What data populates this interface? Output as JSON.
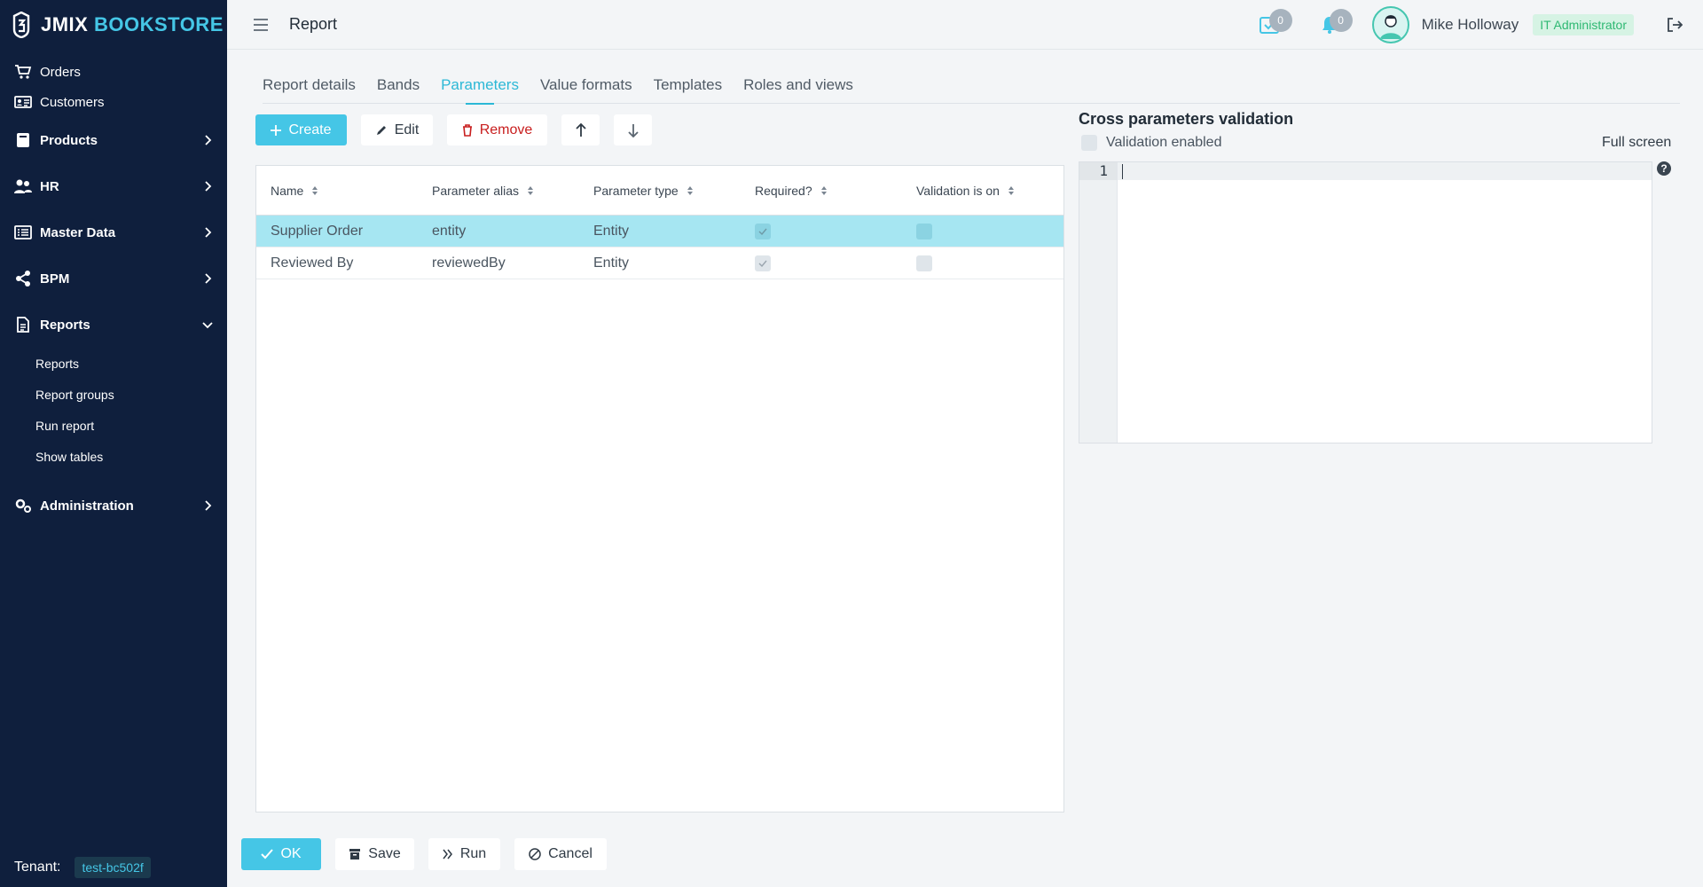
{
  "app": {
    "brand_left": "JMIX",
    "brand_right": "BOOKSTORE"
  },
  "sidebar": {
    "items": [
      {
        "label": "Orders"
      },
      {
        "label": "Customers"
      },
      {
        "label": "Products"
      },
      {
        "label": "HR"
      },
      {
        "label": "Master Data"
      },
      {
        "label": "BPM"
      },
      {
        "label": "Reports"
      },
      {
        "label": "Administration"
      }
    ],
    "reports_sub": [
      {
        "label": "Reports"
      },
      {
        "label": "Report groups"
      },
      {
        "label": "Run report"
      },
      {
        "label": "Show tables"
      }
    ],
    "tenant_label": "Tenant:",
    "tenant_value": "test-bc502f"
  },
  "header": {
    "title": "Report",
    "inbox_count": "0",
    "notifications_count": "0",
    "user_name": "Mike Holloway",
    "role": "IT Administrator"
  },
  "tabs": [
    {
      "label": "Report details"
    },
    {
      "label": "Bands"
    },
    {
      "label": "Parameters",
      "active": true
    },
    {
      "label": "Value formats"
    },
    {
      "label": "Templates"
    },
    {
      "label": "Roles and views"
    }
  ],
  "toolbar": {
    "create": "Create",
    "edit": "Edit",
    "remove": "Remove"
  },
  "table": {
    "columns": [
      "Name",
      "Parameter alias",
      "Parameter type",
      "Required?",
      "Validation is on"
    ],
    "rows": [
      {
        "name": "Supplier Order",
        "alias": "entity",
        "type": "Entity",
        "required": true,
        "validation": false
      },
      {
        "name": "Reviewed By",
        "alias": "reviewedBy",
        "type": "Entity",
        "required": true,
        "validation": false
      }
    ]
  },
  "validation_panel": {
    "title": "Cross parameters validation",
    "enabled_label": "Validation enabled",
    "fullscreen": "Full screen",
    "line_number": "1",
    "help": "?"
  },
  "footer": {
    "ok": "OK",
    "save": "Save",
    "run": "Run",
    "cancel": "Cancel"
  },
  "colors": {
    "sidebar_bg": "#0f1f3d",
    "accent": "#45c6e6",
    "danger": "#c81e1e",
    "selected_row": "#a6e6f2"
  }
}
